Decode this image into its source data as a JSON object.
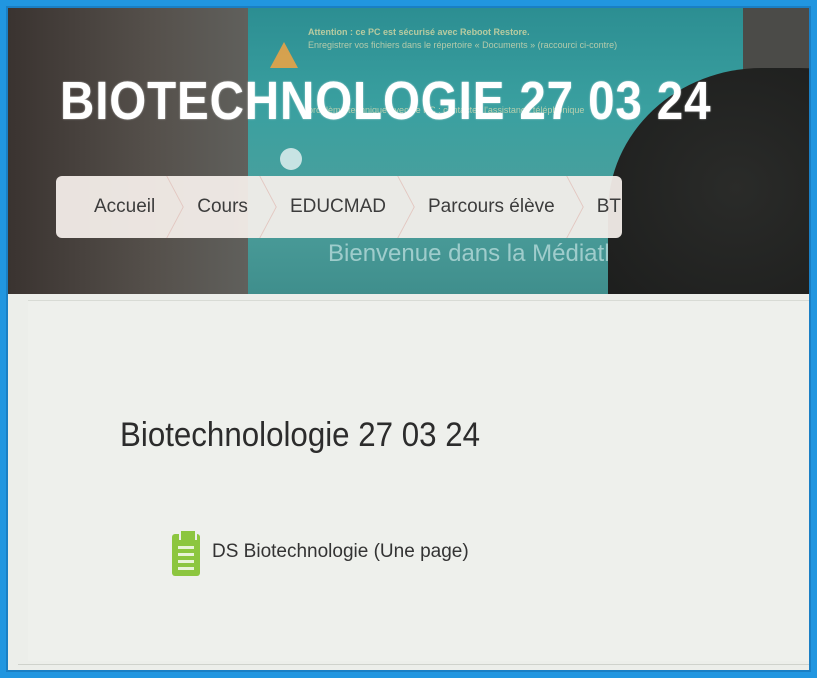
{
  "site": {
    "title": "BIOTECHNOLOGIE 27 03 24"
  },
  "background_screen": {
    "notice_line1": "Attention : ce PC est sécurisé avec Reboot Restore.",
    "notice_line2": "Enregistrer vos fichiers dans le répertoire « Documents » (raccourci ci-contre)",
    "notice_line3": "problème technique avec ce PC : contactez l'assistance téléphonique",
    "welcome": "Bienvenue dans la Médiathèque"
  },
  "nav": {
    "items": [
      {
        "label": "Accueil"
      },
      {
        "label": "Cours"
      },
      {
        "label": "EDUCMAD"
      },
      {
        "label": "Parcours élève"
      },
      {
        "label": "BT"
      }
    ]
  },
  "main": {
    "section_title": "Biotechnolologie 27 03 24",
    "activities": [
      {
        "label": "DS Biotechnologie (Une page)",
        "icon": "page-icon"
      }
    ]
  },
  "colors": {
    "accent_icon": "#8cc63f",
    "frame_border": "#2196e0"
  }
}
